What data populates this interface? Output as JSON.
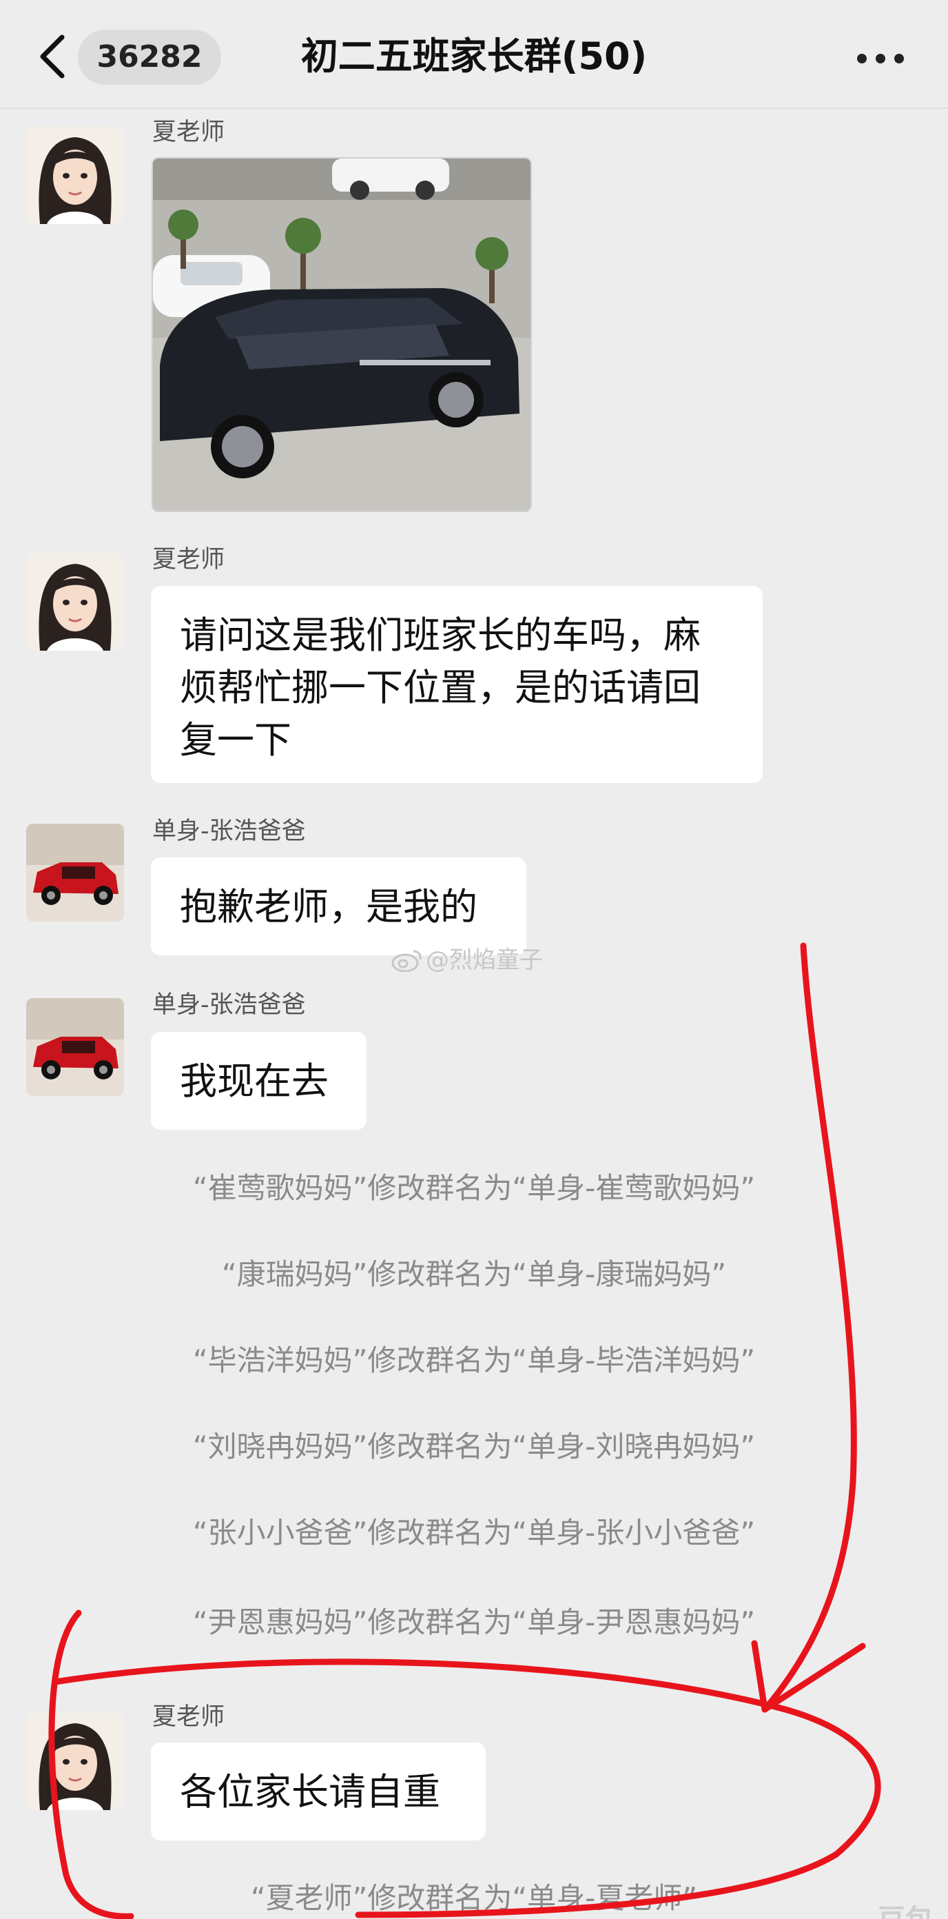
{
  "header": {
    "back_icon": "chevron-left-icon",
    "unread_count": "36282",
    "title": "初二五班家长群(50)",
    "more_icon": "more-horizontal-icon"
  },
  "messages": [
    {
      "sender": "夏老师",
      "type": "image",
      "image_description_icon": "car-photo"
    },
    {
      "sender": "夏老师",
      "lines": [
        "请问这是我们班家长的车吗，麻",
        "烦帮忙挪一下位置，是的话请回",
        "复一下"
      ]
    },
    {
      "sender": "单身-张浩爸爸",
      "text": "抱歉老师，是我的"
    },
    {
      "sender": "单身-张浩爸爸",
      "text": "我现在去"
    }
  ],
  "system_notices": [
    "“崔莺歌妈妈”修改群名为“单身-崔莺歌妈妈”",
    "“康瑞妈妈”修改群名为“单身-康瑞妈妈”",
    "“毕浩洋妈妈”修改群名为“单身-毕浩洋妈妈”",
    "“刘晓冉妈妈”修改群名为“单身-刘晓冉妈妈”",
    "“张小小爸爸”修改群名为“单身-张小小爸爸”",
    "“尹恩惠妈妈”修改群名为“单身-尹恩惠妈妈”"
  ],
  "last_message": {
    "sender": "夏老师",
    "text": "各位家长请自重"
  },
  "last_notice": "“夏老师”修改群名为“单身-夏老师”",
  "watermark": "@烈焰童子",
  "corner_mark": "豆包",
  "colors": {
    "background": "#ededed",
    "bubble": "#ffffff",
    "annotation": "#e8141c",
    "system_text": "#8a8a8a"
  }
}
